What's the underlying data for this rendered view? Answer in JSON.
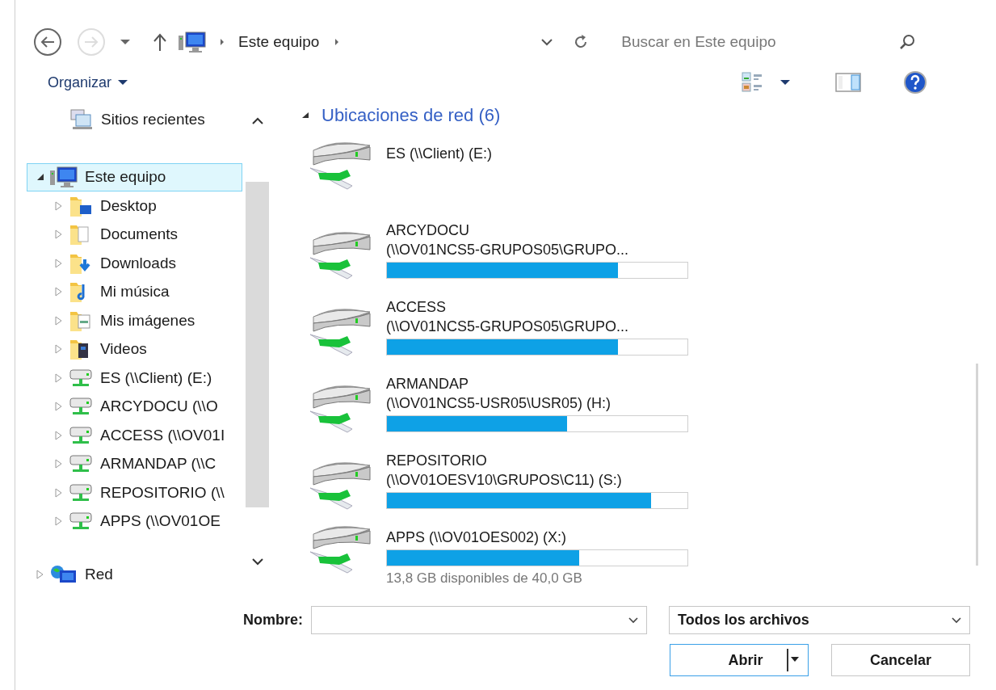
{
  "toolbar": {
    "nav_buttons": [
      {
        "kind": "back",
        "disabled": false
      },
      {
        "kind": "forward",
        "disabled": true
      }
    ],
    "breadcrumb": [
      "Este equipo"
    ],
    "search": {
      "placeholder": "Buscar en Este equipo"
    }
  },
  "command_bar": {
    "organize": "Organizar"
  },
  "sidebar": {
    "favorites": [
      {
        "label": "Sitios recientes",
        "kind": "recent",
        "selected": false
      }
    ],
    "items": [
      {
        "label": "Este equipo",
        "kind": "computer",
        "selected": true,
        "expanded": true,
        "children": [
          {
            "label": "Desktop",
            "kind": "desktop",
            "selected": false,
            "expanded": false
          },
          {
            "label": "Documents",
            "kind": "documents",
            "selected": false,
            "expanded": false
          },
          {
            "label": "Downloads",
            "kind": "downloads",
            "selected": false,
            "expanded": false
          },
          {
            "label": "Mi música",
            "kind": "music",
            "selected": false,
            "expanded": false
          },
          {
            "label": "Mis imágenes",
            "kind": "pictures",
            "selected": false,
            "expanded": false
          },
          {
            "label": "Videos",
            "kind": "videos",
            "selected": false,
            "expanded": false
          },
          {
            "label": "ES (\\\\Client) (E:)",
            "kind": "netdrive",
            "selected": false,
            "expanded": false
          },
          {
            "label": "ARCYDOCU (\\\\O",
            "kind": "netdrive",
            "selected": false,
            "expanded": false
          },
          {
            "label": "ACCESS (\\\\OV01I",
            "kind": "netdrive",
            "selected": false,
            "expanded": false
          },
          {
            "label": "ARMANDAP (\\\\C",
            "kind": "netdrive",
            "selected": false,
            "expanded": false
          },
          {
            "label": "REPOSITORIO (\\\\",
            "kind": "netdrive",
            "selected": false,
            "expanded": false
          },
          {
            "label": "APPS (\\\\OV01OE",
            "kind": "netdrive",
            "selected": false,
            "expanded": false
          }
        ]
      },
      {
        "label": "Red",
        "kind": "network",
        "selected": false,
        "expanded": false
      }
    ]
  },
  "content": {
    "group_title": "Ubicaciones de red (6)",
    "drives": [
      {
        "lines": [
          "ES (\\\\Client) (E:)"
        ]
      },
      {
        "lines": [
          "ARCYDOCU",
          "(\\\\OV01NCS5-GRUPOS05\\GRUPO..."
        ],
        "level": 0.77
      },
      {
        "lines": [
          "ACCESS",
          "(\\\\OV01NCS5-GRUPOS05\\GRUPO..."
        ],
        "level": 0.77
      },
      {
        "lines": [
          "ARMANDAP",
          "(\\\\OV01NCS5-USR05\\USR05) (H:)"
        ],
        "level": 0.6
      },
      {
        "lines": [
          "REPOSITORIO",
          "(\\\\OV01OESV10\\GRUPOS\\C11) (S:)"
        ],
        "level": 0.88
      },
      {
        "lines": [
          "APPS (\\\\OV01OES002) (X:)"
        ],
        "level": 0.64,
        "detail": "13,8 GB disponibles de 40,0 GB"
      }
    ]
  },
  "footer": {
    "filename_label": "Nombre:",
    "filter": "Todos los archivos",
    "buttons": [
      {
        "label": "Abrir",
        "default": true,
        "split": true
      },
      {
        "label": "Cancelar",
        "default": false,
        "split": false
      }
    ]
  }
}
